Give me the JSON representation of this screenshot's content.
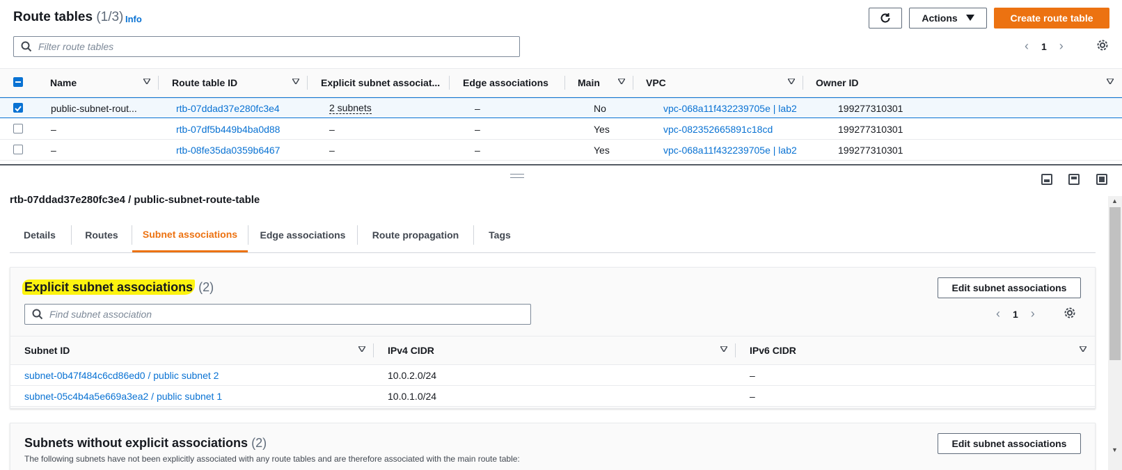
{
  "header": {
    "title": "Route tables",
    "count": "(1/3)",
    "info": "Info",
    "actions_label": "Actions",
    "create_label": "Create route table",
    "search_placeholder": "Filter route tables",
    "page": "1"
  },
  "table": {
    "columns": [
      "Name",
      "Route table ID",
      "Explicit subnet associat...",
      "Edge associations",
      "Main",
      "VPC",
      "Owner ID"
    ],
    "rows": [
      {
        "name": "public-subnet-rout...",
        "id": "rtb-07ddad37e280fc3e4",
        "explicit": "2 subnets",
        "edge": "–",
        "main": "No",
        "vpc": "vpc-068a11f432239705e | lab2",
        "owner": "199277310301",
        "selected": true
      },
      {
        "name": "–",
        "id": "rtb-07df5b449b4ba0d88",
        "explicit": "–",
        "edge": "–",
        "main": "Yes",
        "vpc": "vpc-082352665891c18cd",
        "owner": "199277310301",
        "selected": false
      },
      {
        "name": "–",
        "id": "rtb-08fe35da0359b6467",
        "explicit": "–",
        "edge": "–",
        "main": "Yes",
        "vpc": "vpc-068a11f432239705e | lab2",
        "owner": "199277310301",
        "selected": false
      }
    ]
  },
  "detail": {
    "title": "rtb-07ddad37e280fc3e4 / public-subnet-route-table",
    "tabs": [
      "Details",
      "Routes",
      "Subnet associations",
      "Edge associations",
      "Route propagation",
      "Tags"
    ],
    "active_tab": "Subnet associations"
  },
  "explicit": {
    "title": "Explicit subnet associations",
    "count": "(2)",
    "edit_label": "Edit subnet associations",
    "search_placeholder": "Find subnet association",
    "page": "1",
    "columns": [
      "Subnet ID",
      "IPv4 CIDR",
      "IPv6 CIDR"
    ],
    "rows": [
      {
        "subnet": "subnet-0b47f484c6cd86ed0 / public subnet 2",
        "ipv4": "10.0.2.0/24",
        "ipv6": "–"
      },
      {
        "subnet": "subnet-05c4b4a5e669a3ea2 / public subnet 1",
        "ipv4": "10.0.1.0/24",
        "ipv6": "–"
      }
    ]
  },
  "without": {
    "title": "Subnets without explicit associations",
    "count": "(2)",
    "edit_label": "Edit subnet associations",
    "description": "The following subnets have not been explicitly associated with any route tables and are therefore associated with the main route table:"
  },
  "colors": {
    "accent": "#ec7211",
    "link": "#0972d3",
    "highlight": "#fdf30f"
  }
}
